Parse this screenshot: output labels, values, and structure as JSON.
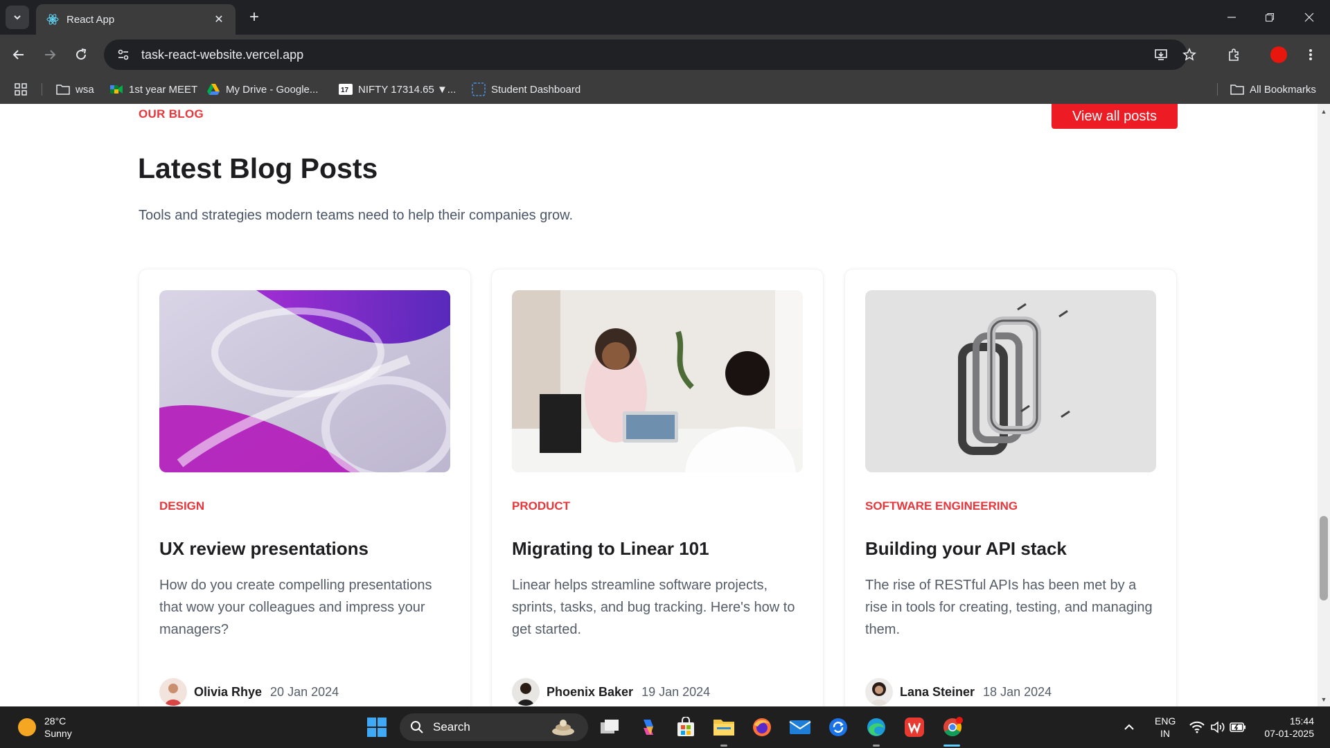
{
  "browser": {
    "tab_title": "React App",
    "url": "task-react-website.vercel.app",
    "bookmarks": [
      {
        "label": "wsa",
        "icon": "folder-icon"
      },
      {
        "label": "1st year MEET",
        "icon": "google-meet-icon"
      },
      {
        "label": "My Drive - Google...",
        "icon": "google-drive-icon"
      },
      {
        "label": "NIFTY 17314.65 ▼...",
        "icon": "tradingview-icon"
      },
      {
        "label": "Student Dashboard",
        "icon": "dashboard-icon"
      }
    ],
    "all_bookmarks_label": "All Bookmarks"
  },
  "page": {
    "eyebrow": "OUR BLOG",
    "view_all_label": "View all posts",
    "heading": "Latest Blog Posts",
    "subtitle": "Tools and strategies modern teams need to help their companies grow.",
    "posts": [
      {
        "category": "DESIGN",
        "title": "UX review presentations",
        "description": "How do you create compelling presentations that wow your colleagues and impress your managers?",
        "author": "Olivia Rhye",
        "date": "20 Jan 2024"
      },
      {
        "category": "PRODUCT",
        "title": "Migrating to Linear 101",
        "description": "Linear helps streamline software projects, sprints, tasks, and bug tracking. Here's how to get started.",
        "author": "Phoenix Baker",
        "date": "19 Jan 2024"
      },
      {
        "category": "SOFTWARE ENGINEERING",
        "title": "Building your API stack",
        "description": "The rise of RESTful APIs has been met by a rise in tools for creating, testing, and managing them.",
        "author": "Lana Steiner",
        "date": "18 Jan 2024"
      }
    ],
    "accent_color": "#e8363b",
    "button_color": "#ed1b24"
  },
  "taskbar": {
    "weather_temp": "28°C",
    "weather_desc": "Sunny",
    "search_label": "Search",
    "lang_top": "ENG",
    "lang_bottom": "IN",
    "time": "15:44",
    "date": "07-01-2025"
  }
}
